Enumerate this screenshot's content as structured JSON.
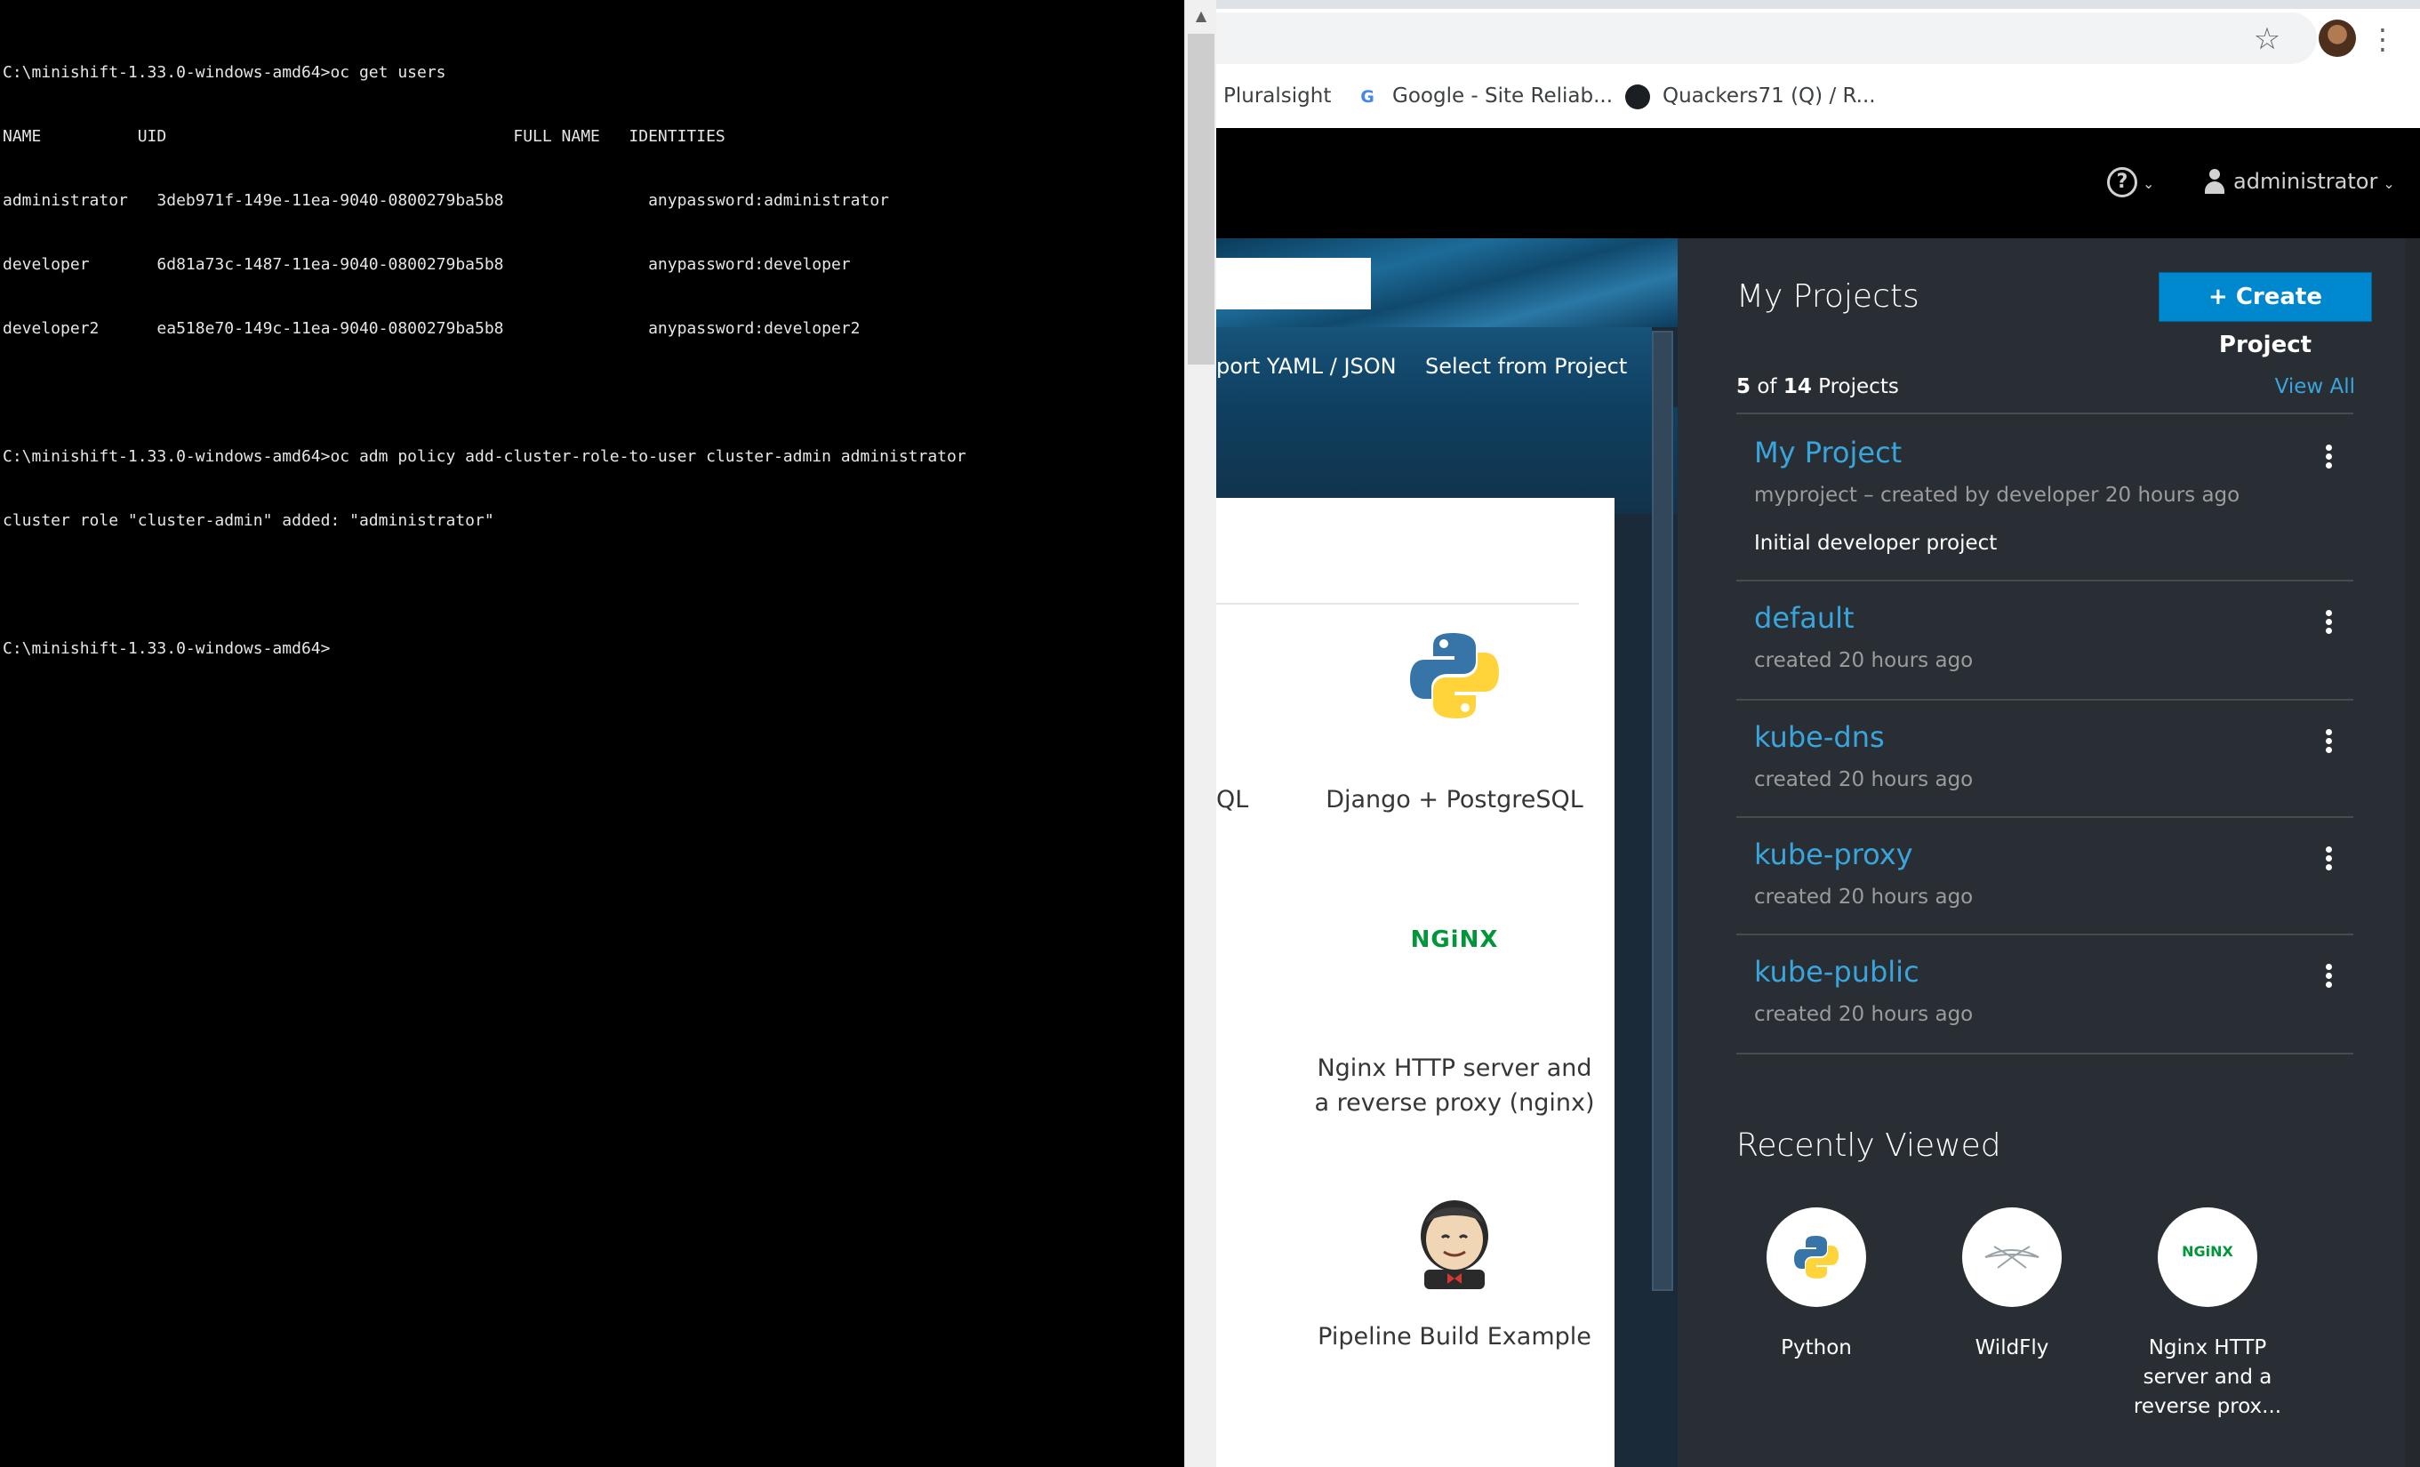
{
  "terminal": {
    "lines": [
      "C:\\minishift-1.33.0-windows-amd64>oc get users",
      "NAME          UID                                    FULL NAME   IDENTITIES",
      "administrator   3deb971f-149e-11ea-9040-0800279ba5b8               anypassword:administrator",
      "developer       6d81a73c-1487-11ea-9040-0800279ba5b8               anypassword:developer",
      "developer2      ea518e70-149c-11ea-9040-0800279ba5b8               anypassword:developer2",
      "",
      "C:\\minishift-1.33.0-windows-amd64>oc adm policy add-cluster-role-to-user cluster-admin administrator",
      "cluster role \"cluster-admin\" added: \"administrator\"",
      "",
      "C:\\minishift-1.33.0-windows-amd64>"
    ]
  },
  "browser": {
    "star_glyph": "☆",
    "menu_glyph": "⋮",
    "bookmarks": [
      {
        "label": "Pluralsight",
        "icon": "pluralsight-icon"
      },
      {
        "label": "Google - Site Reliab...",
        "icon": "google-icon"
      },
      {
        "label": "Quackers71 (Q) / R...",
        "icon": "github-icon"
      }
    ]
  },
  "header": {
    "help_glyph": "?",
    "chevron_glyph": "⌄",
    "user": "administrator"
  },
  "landing": {
    "import_yaml": "port YAML / JSON",
    "select_from_project": "Select from Project",
    "catalog": {
      "partial_label": "QL",
      "items": [
        {
          "label": "Django + PostgreSQL",
          "icon": "python-icon"
        },
        {
          "label_line1": "Nginx HTTP server and",
          "label_line2": "a reverse proxy (nginx)",
          "icon": "nginx-icon"
        },
        {
          "label": "Pipeline Build Example",
          "icon": "jenkins-icon"
        }
      ],
      "nginx_logo_text": "NGiNX"
    }
  },
  "projects": {
    "title": "My Projects",
    "create_button": "Create Project",
    "create_icon": "+",
    "count_shown": "5",
    "count_of": "of",
    "count_total": "14",
    "count_suffix": "Projects",
    "view_all": "View All",
    "items": [
      {
        "name": "My Project",
        "meta": "myproject – created by developer 20 hours ago",
        "description": "Initial developer project"
      },
      {
        "name": "default",
        "meta": "created 20 hours ago"
      },
      {
        "name": "kube-dns",
        "meta": "created 20 hours ago"
      },
      {
        "name": "kube-proxy",
        "meta": "created 20 hours ago"
      },
      {
        "name": "kube-public",
        "meta": "created 20 hours ago"
      }
    ],
    "recent_title": "Recently Viewed",
    "recent": [
      {
        "label": "Python",
        "icon": "python-icon"
      },
      {
        "label": "WildFly",
        "icon": "wildfly-icon"
      },
      {
        "label_line1": "Nginx HTTP",
        "label_line2": "server and a",
        "label_line3": "reverse prox...",
        "icon": "nginx-icon",
        "logo_text": "NGiNX"
      }
    ]
  },
  "colors": {
    "accent": "#0088ce",
    "link": "#39a5dc",
    "panel_bg": "#292e34",
    "terminal_bg": "#000000"
  }
}
